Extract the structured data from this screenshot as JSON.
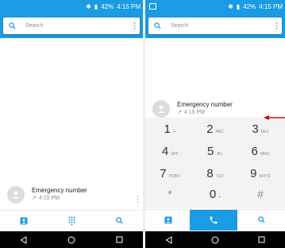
{
  "status": {
    "battery": "42%",
    "time": "4:15 PM"
  },
  "search": {
    "placeholder": "Search"
  },
  "call_log": {
    "name": "Emergency number",
    "time": "4:15 PM"
  },
  "dialpad": {
    "keys": [
      {
        "digit": "1",
        "letters": "∞"
      },
      {
        "digit": "2",
        "letters": "ABC"
      },
      {
        "digit": "3",
        "letters": "DEF"
      },
      {
        "digit": "4",
        "letters": "GHI"
      },
      {
        "digit": "5",
        "letters": "JKL"
      },
      {
        "digit": "6",
        "letters": "MNO"
      },
      {
        "digit": "7",
        "letters": "PQRS"
      },
      {
        "digit": "8",
        "letters": "TUV"
      },
      {
        "digit": "9",
        "letters": "WXYZ"
      },
      {
        "digit": "*",
        "letters": ""
      },
      {
        "digit": "0",
        "letters": "+"
      },
      {
        "digit": "#",
        "letters": ""
      }
    ]
  },
  "colors": {
    "accent": "#1a9be3",
    "annotation_arrow": "#cc1111"
  },
  "icons": {
    "search": "search-icon",
    "more": "more-vert-icon",
    "contacts": "contacts-icon",
    "dialpad": "dialpad-icon",
    "call": "phone-icon",
    "back": "back-icon",
    "home": "home-icon",
    "recents": "recents-icon"
  }
}
